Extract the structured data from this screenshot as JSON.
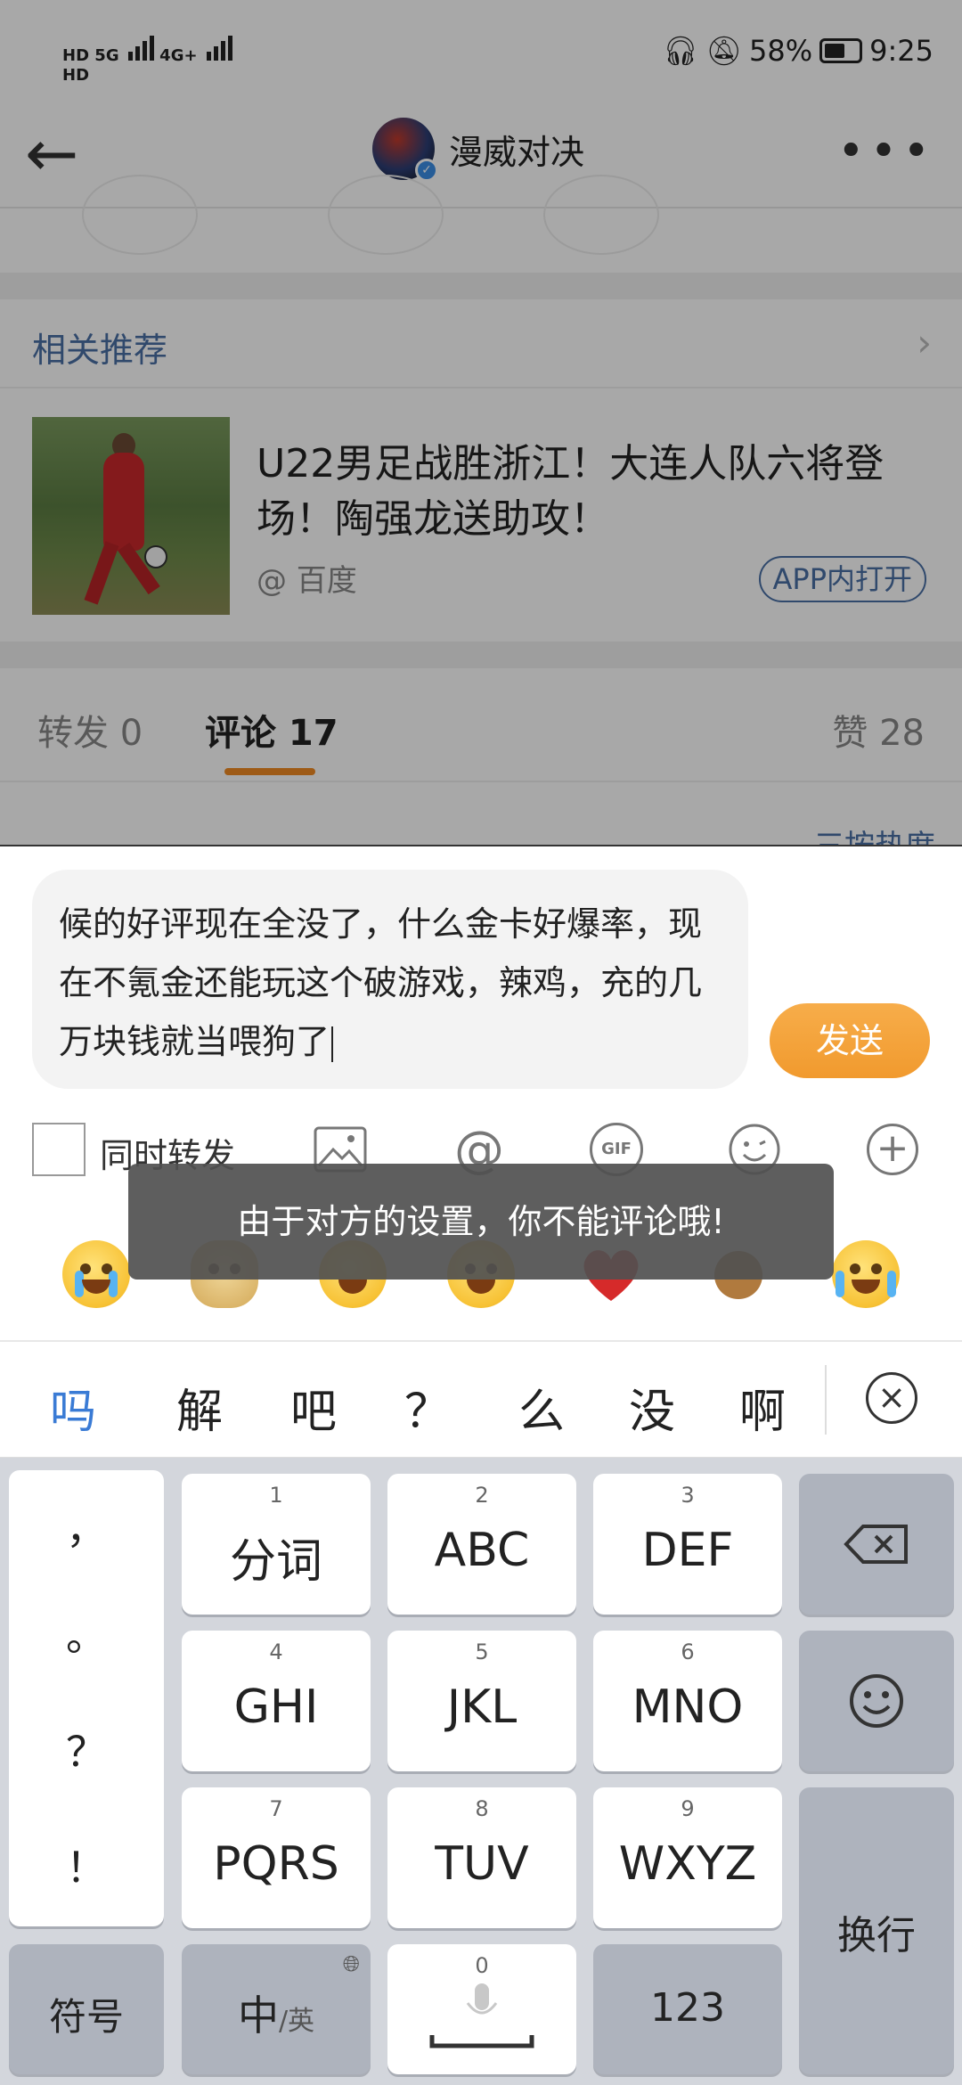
{
  "status_bar": {
    "left_indicators": [
      "HD",
      "HD",
      "5G",
      "4G+"
    ],
    "battery_percent": "58%",
    "time": "9:25"
  },
  "nav": {
    "title": "漫威对决",
    "back_icon": "arrow-left-icon",
    "more_icon": "more-dots-icon"
  },
  "recommend": {
    "header": "相关推荐",
    "article": {
      "title": "U22男足战胜浙江！大连人队六将登场！陶强龙送助攻！",
      "source": "@ 百度",
      "open_label": "APP内打开"
    }
  },
  "tabs": {
    "repost": "转发 0",
    "comment": "评论 17",
    "like": "赞 28",
    "sort_peek": "三按热度"
  },
  "composer": {
    "text": "候的好评现在全没了，什么金卡好爆率，现在不氪金还能玩这个破游戏，辣鸡，充的几万块钱就当喂狗了",
    "send_label": "发送",
    "also_repost_label": "同时转发",
    "toolbar_icons": [
      "image-icon",
      "at-icon",
      "gif-icon",
      "emoji-icon",
      "plus-icon"
    ],
    "at_symbol": "@",
    "gif_text": "GIF",
    "plus_symbol": "+"
  },
  "toast": {
    "message": "由于对方的设置，你不能评论哦!"
  },
  "emoji_row": [
    "crying-face",
    "doge-face",
    "laughing-tears-face",
    "party-face",
    "red-heart",
    "thumbs-person",
    "joy-face"
  ],
  "candidates": {
    "items": [
      "吗",
      "解",
      "吧",
      "？",
      "么",
      "没",
      "啊"
    ],
    "close_icon": "close-circle-icon"
  },
  "keyboard": {
    "punct_column": [
      "，",
      "。",
      "？",
      "！"
    ],
    "keys": [
      {
        "num": "1",
        "label": "分词"
      },
      {
        "num": "2",
        "label": "ABC"
      },
      {
        "num": "3",
        "label": "DEF"
      },
      {
        "num": "4",
        "label": "GHI"
      },
      {
        "num": "5",
        "label": "JKL"
      },
      {
        "num": "6",
        "label": "MNO"
      },
      {
        "num": "7",
        "label": "PQRS"
      },
      {
        "num": "8",
        "label": "TUV"
      },
      {
        "num": "9",
        "label": "WXYZ"
      }
    ],
    "symbols_label": "符号",
    "lang_label_main": "中",
    "lang_label_sub": "/英",
    "space_num": "0",
    "num_label": "123",
    "enter_label": "换行",
    "delete_icon": "backspace-icon",
    "emoji_icon": "smiley-icon",
    "mic_icon": "microphone-icon",
    "globe_icon": "globe-icon"
  }
}
